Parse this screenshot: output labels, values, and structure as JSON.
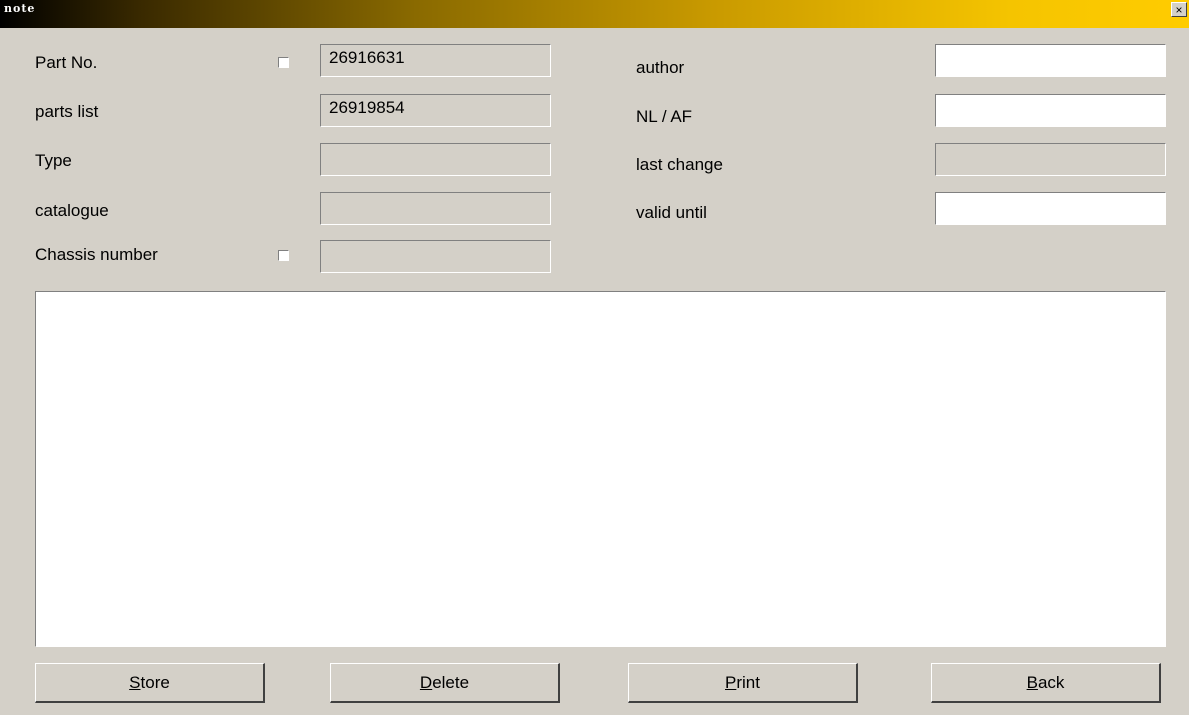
{
  "window": {
    "title": "note",
    "close": "×"
  },
  "form": {
    "part_no": {
      "label": "Part No.",
      "value": "26916631"
    },
    "parts_list": {
      "label": "parts list",
      "value": "26919854"
    },
    "type": {
      "label": "Type",
      "value": ""
    },
    "catalogue": {
      "label": "catalogue",
      "value": ""
    },
    "chassis_number": {
      "label": "Chassis number",
      "value": ""
    },
    "author": {
      "label": "author",
      "value": ""
    },
    "nl_af": {
      "label": "NL / AF",
      "value": ""
    },
    "last_change": {
      "label": "last change",
      "value": ""
    },
    "valid_until": {
      "label": "valid until",
      "value": ""
    }
  },
  "note_text": "",
  "buttons": {
    "store": {
      "mnemonic": "S",
      "rest": "tore"
    },
    "delete": {
      "mnemonic": "D",
      "rest": "elete"
    },
    "print": {
      "mnemonic": "P",
      "rest": "rint"
    },
    "back": {
      "mnemonic": "B",
      "rest": "ack"
    }
  }
}
